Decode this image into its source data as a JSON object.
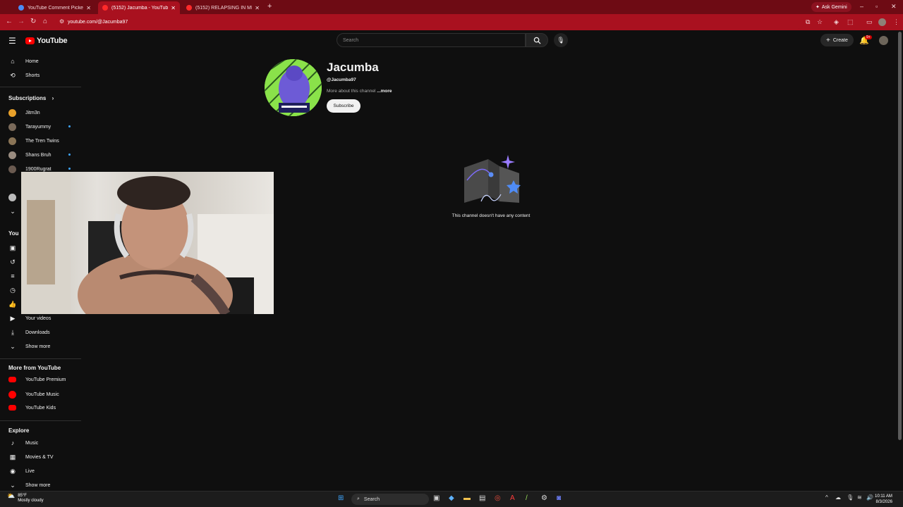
{
  "browser": {
    "tabs": [
      {
        "title": "YouTube Comment Picker — R",
        "active": false
      },
      {
        "title": "(5152) Jacumba - YouTube",
        "active": true
      },
      {
        "title": "(5152) RELAPSING IN MEXICO",
        "active": false
      }
    ],
    "ask_gemini": "Ask Gemini",
    "url": "youtube.com/@Jacumba97"
  },
  "masthead": {
    "logo_text": "YouTube",
    "search_placeholder": "Search",
    "create_label": "Create",
    "notification_badge": "9+"
  },
  "sidebar": {
    "main": [
      {
        "label": "Home",
        "icon": "home-icon"
      },
      {
        "label": "Shorts",
        "icon": "shorts-icon"
      }
    ],
    "subscriptions_header": "Subscriptions",
    "subscriptions": [
      {
        "label": "Jitm3n",
        "color": "#e8a02a",
        "new": false
      },
      {
        "label": "Tarayummy",
        "color": "#7a6a5a",
        "new": true
      },
      {
        "label": "The Tren Twins",
        "color": "#8a7456",
        "new": false
      },
      {
        "label": "Shans Bruh",
        "color": "#9a8c80",
        "new": true
      },
      {
        "label": "1900Rugrat",
        "color": "#6a5a50",
        "new": true
      }
    ],
    "you_header": "You",
    "you_items": [
      {
        "label": "Your videos",
        "icon": "your-videos-icon"
      },
      {
        "label": "Downloads",
        "icon": "download-icon"
      },
      {
        "label": "Show more",
        "icon": "chevron-down-icon"
      }
    ],
    "more_header": "More from YouTube",
    "more_items": [
      {
        "label": "YouTube Premium"
      },
      {
        "label": "YouTube Music"
      },
      {
        "label": "YouTube Kids"
      }
    ],
    "explore_header": "Explore",
    "explore_items": [
      {
        "label": "Music",
        "icon": "music-icon"
      },
      {
        "label": "Movies & TV",
        "icon": "movies-icon"
      },
      {
        "label": "Live",
        "icon": "live-icon"
      },
      {
        "label": "Show more",
        "icon": "chevron-down-icon"
      }
    ]
  },
  "channel": {
    "name": "Jacumba",
    "handle": "@Jacumba97",
    "about": "More about this channel",
    "more": "...more",
    "subscribe": "Subscribe",
    "empty_message": "This channel doesn't have any content"
  },
  "taskbar": {
    "temperature": "85°F",
    "weather": "Mostly cloudy",
    "search": "Search",
    "time": "10:11 AM",
    "date": "8/3/2026"
  },
  "colors": {
    "browser_frame": "#6e0b14",
    "browser_active": "#a9111f",
    "youtube_red": "#ff0000",
    "background": "#0f0f0f"
  }
}
